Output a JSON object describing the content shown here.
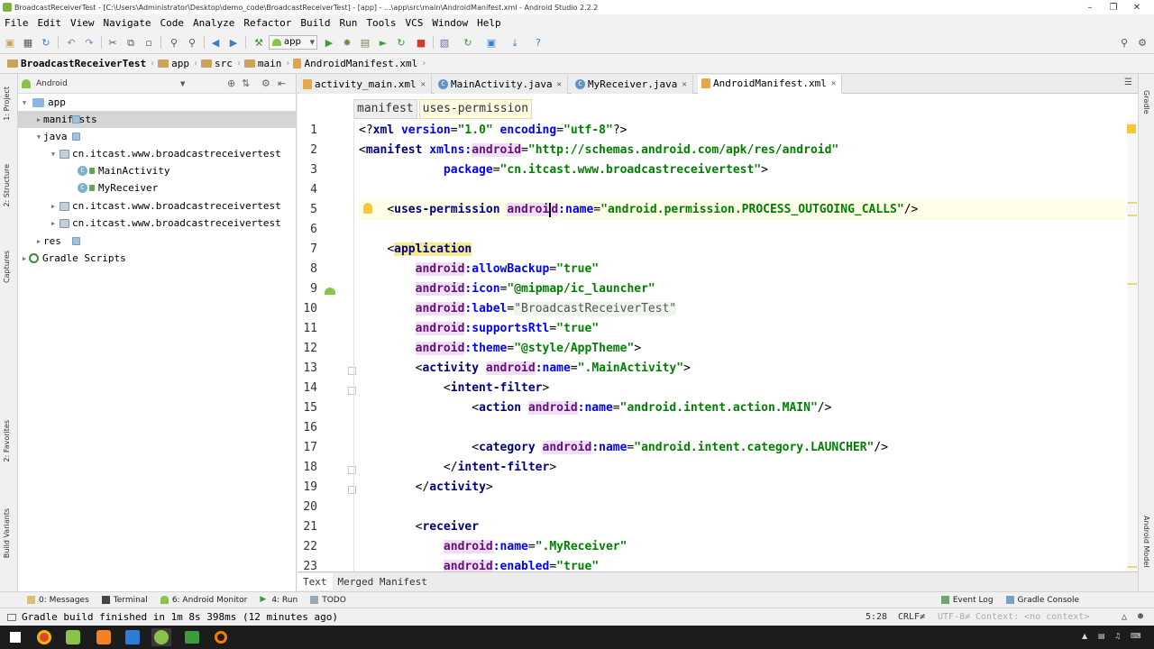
{
  "window": {
    "title": "BroadcastReceiverTest - [C:\\Users\\Administrator\\Desktop\\demo_code\\BroadcastReceiverTest] - [app] - ...\\app\\src\\main\\AndroidManifest.xml - Android Studio 2.2.2"
  },
  "menu": [
    "File",
    "Edit",
    "View",
    "Navigate",
    "Code",
    "Analyze",
    "Refactor",
    "Build",
    "Run",
    "Tools",
    "VCS",
    "Window",
    "Help"
  ],
  "toolbar": {
    "config": "app"
  },
  "navbar": [
    "BroadcastReceiverTest",
    "app",
    "src",
    "main",
    "AndroidManifest.xml"
  ],
  "left_strip": [
    "1: Project",
    "2: Structure",
    "Captures",
    "2: Favorites",
    "Build Variants"
  ],
  "right_strip": [
    "Gradle",
    "Android Model"
  ],
  "project": {
    "view": "Android",
    "tree": [
      {
        "label": "app"
      },
      {
        "label": "manifests"
      },
      {
        "label": "java"
      },
      {
        "label": "cn.itcast.www.broadcastreceivertest"
      },
      {
        "label": "MainActivity"
      },
      {
        "label": "MyReceiver"
      },
      {
        "label": "cn.itcast.www.broadcastreceivertest"
      },
      {
        "label": "cn.itcast.www.broadcastreceivertest"
      },
      {
        "label": "res"
      },
      {
        "label": "Gradle Scripts"
      }
    ]
  },
  "tabs": [
    {
      "label": "activity_main.xml"
    },
    {
      "label": "MainActivity.java"
    },
    {
      "label": "MyReceiver.java"
    },
    {
      "label": "AndroidManifest.xml"
    }
  ],
  "breadcrumbs": [
    "manifest",
    "uses-permission"
  ],
  "line_numbers": [
    "1",
    "2",
    "3",
    "4",
    "5",
    "6",
    "7",
    "8",
    "9",
    "10",
    "11",
    "12",
    "13",
    "14",
    "15",
    "16",
    "17",
    "18",
    "19",
    "20",
    "21",
    "22",
    "23"
  ],
  "code": {
    "l1_a": "<?",
    "l1_b": "xml ",
    "l1_c": "version",
    "l1_d": "=",
    "l1_e": "\"1.0\"",
    "l1_f": " encoding",
    "l1_g": "=",
    "l1_h": "\"utf-8\"",
    "l1_i": "?>",
    "l2_a": "<",
    "l2_b": "manifest ",
    "l2_c": "xmlns:",
    "l2_d": "android",
    "l2_e": "=",
    "l2_f": "\"http://schemas.android.com/apk/res/android\"",
    "l3_a": "package",
    "l3_b": "=",
    "l3_c": "\"cn.itcast.www.broadcastreceivertest\"",
    "l3_d": ">",
    "l5_a": "<",
    "l5_b": "uses-permission ",
    "l5_c": "androi",
    "l5_c2": "d",
    "l5_d": ":name",
    "l5_e": "=",
    "l5_f": "\"android.permission.PROCESS_OUTGOING_CALLS\"",
    "l5_g": "/>",
    "l7_a": "<",
    "l7_b": "application",
    "l8_a": "android",
    "l8_b": ":allowBackup",
    "l8_c": "=",
    "l8_d": "\"true\"",
    "l9_a": "android",
    "l9_b": ":icon",
    "l9_c": "=",
    "l9_d": "\"@mipmap/ic_launcher\"",
    "l10_a": "android",
    "l10_b": ":label",
    "l10_c": "=",
    "l10_d": "\"BroadcastReceiverTest\"",
    "l11_a": "android",
    "l11_b": ":supportsRtl",
    "l11_c": "=",
    "l11_d": "\"true\"",
    "l12_a": "android",
    "l12_b": ":theme",
    "l12_c": "=",
    "l12_d": "\"@style/AppTheme\"",
    "l12_e": ">",
    "l13_a": "<",
    "l13_b": "activity ",
    "l13_c": "android",
    "l13_d": ":name",
    "l13_e": "=",
    "l13_f": "\".MainActivity\"",
    "l13_g": ">",
    "l14_a": "<",
    "l14_b": "intent-filter",
    "l14_c": ">",
    "l15_a": "<",
    "l15_b": "action ",
    "l15_c": "android",
    "l15_d": ":name",
    "l15_e": "=",
    "l15_f": "\"android.intent.action.MAIN\"",
    "l15_g": "/>",
    "l17_a": "<",
    "l17_b": "category ",
    "l17_c": "android",
    "l17_d": ":name",
    "l17_e": "=",
    "l17_f": "\"android.intent.category.LAUNCHER\"",
    "l17_g": "/>",
    "l18_a": "</",
    "l18_b": "intent-filter",
    "l18_c": ">",
    "l19_a": "</",
    "l19_b": "activity",
    "l19_c": ">",
    "l21_a": "<",
    "l21_b": "receiver",
    "l22_a": "android",
    "l22_b": ":name",
    "l22_c": "=",
    "l22_d": "\".MyReceiver\"",
    "l23_a": "android",
    "l23_b": ":enabled",
    "l23_c": "=",
    "l23_d": "\"true\""
  },
  "bottom_tabs": [
    "Text",
    "Merged Manifest"
  ],
  "toolwindows": {
    "messages": "0: Messages",
    "terminal": "Terminal",
    "monitor": "6: Android Monitor",
    "run": "4: Run",
    "todo": "TODO",
    "eventlog": "Event Log",
    "gradle_console": "Gradle Console"
  },
  "status": {
    "message": "Gradle build finished in 1m 8s 398ms (12 minutes ago)",
    "position": "5:28",
    "line_sep": "CRLF≠",
    "encoding": "UTF-8≠",
    "context": "Context: <no context>"
  },
  "colors": {
    "accent_green": "#8bc34a",
    "tag_blue": "#000080",
    "string_green": "#008000",
    "ns_purple": "#660e7a"
  }
}
